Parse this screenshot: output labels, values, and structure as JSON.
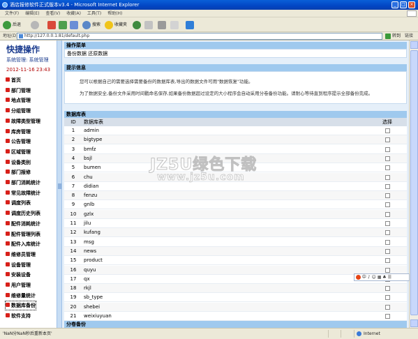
{
  "window": {
    "title": "酒店报修软件正式版本v3.4 - Microsoft Internet Explorer"
  },
  "menu": [
    "文件(F)",
    "编辑(E)",
    "查看(V)",
    "收藏(A)",
    "工具(T)",
    "帮助(H)"
  ],
  "toolbar": {
    "back": "后退",
    "search": "搜索",
    "favorites": "收藏夹"
  },
  "address": {
    "label": "地址(D)",
    "url": "http://127.0.0.1:81/default.php",
    "go": "转到",
    "links": "链接"
  },
  "sidebar": {
    "title": "快捷操作",
    "system": "系统管理: 系统管理",
    "time": "2012-11-16 23:43",
    "items": [
      "首页",
      "部门管理",
      "地点管理",
      "分组管理",
      "故障类型管理",
      "库房管理",
      "公告管理",
      "区域管理",
      "设备类别",
      "部门报修",
      "部门消耗统计",
      "常见故障统计",
      "调度列表",
      "调度历史列表",
      "配件消耗统计",
      "配件管理列表",
      "配件入库统计",
      "维修员管理",
      "设备管理",
      "安装设备",
      "用户管理",
      "维修量统计",
      "数据库备份",
      "软件支持"
    ]
  },
  "main": {
    "ops_header": "操作菜单",
    "ops_links": "备份数据 还原数据",
    "tip_header": "提示信息",
    "tip_line1": "您可以根据自己的需要选择需要备份的数据库表,导出的数据文件可用\"数据恢复\"功能。",
    "tip_line2": "为了数据安全,备份文件采用时间戳命名保存,如果备份数据超过设定的大小程序会自动采用分卷备份功能。请耐心等待直到程序提示全部备份完成。",
    "db_header": "数据库表",
    "col_id": "ID",
    "col_name": "数据库表",
    "col_select": "选择",
    "tables": [
      {
        "id": "1",
        "name": "admin"
      },
      {
        "id": "2",
        "name": "bigtype"
      },
      {
        "id": "3",
        "name": "bmfz"
      },
      {
        "id": "4",
        "name": "bsjl"
      },
      {
        "id": "5",
        "name": "bumen"
      },
      {
        "id": "6",
        "name": "chu"
      },
      {
        "id": "7",
        "name": "didian"
      },
      {
        "id": "8",
        "name": "fenzu"
      },
      {
        "id": "9",
        "name": "gnlb"
      },
      {
        "id": "10",
        "name": "gzlx"
      },
      {
        "id": "11",
        "name": "jilu"
      },
      {
        "id": "12",
        "name": "kufang"
      },
      {
        "id": "13",
        "name": "msg"
      },
      {
        "id": "14",
        "name": "news"
      },
      {
        "id": "15",
        "name": "product"
      },
      {
        "id": "16",
        "name": "quyu"
      },
      {
        "id": "17",
        "name": "qx"
      },
      {
        "id": "18",
        "name": "rkjl"
      },
      {
        "id": "19",
        "name": "sb_type"
      },
      {
        "id": "20",
        "name": "shebei"
      },
      {
        "id": "21",
        "name": "weixiuyuan"
      }
    ],
    "split_header": "分卷备份"
  },
  "watermark": {
    "line1": "JZ5U绿色下载",
    "line2": "www.jz5u.com"
  },
  "ime": "中 ♪ ☺ ▦ ♣ ☰",
  "status": {
    "message": "'NaN分NaN秒后重新本页'",
    "zone": "Internet"
  },
  "colors": {
    "titlebar": "#0246c4",
    "section_header": "#9fc9ee",
    "content_bg": "#e5eff9",
    "accent_red": "#d8201a",
    "sidebar_title": "#1b3c8f"
  }
}
